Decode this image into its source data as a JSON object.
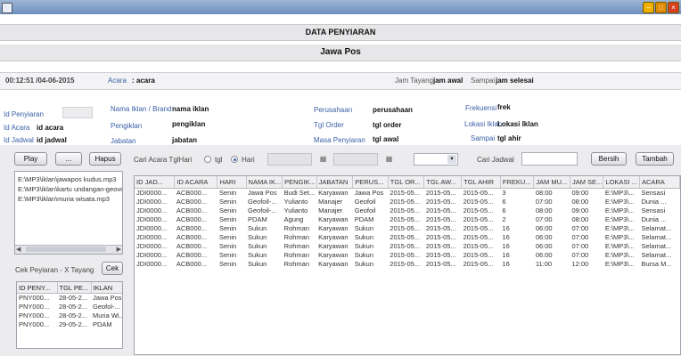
{
  "window": {
    "title": ""
  },
  "header": {
    "title": "DATA PENYIARAN",
    "subtitle": "Jawa Pos"
  },
  "infobar": {
    "clock": "00:12:51  /04-06-2015",
    "acara_label": "Acara",
    "acara_value": ": acara",
    "jam_tayang_label": "Jam Tayang",
    "jam_tayang_value": "jam awal",
    "sampai_label": "Sampai",
    "sampai_value": "jam selesai"
  },
  "form": {
    "id_penyiaran_label": "Id Penyiaran",
    "id_acara_label": "Id Acara",
    "id_acara_value": "id acara",
    "id_jadwal_label": "Id Jadwal",
    "id_jadwal_value": "id jadwal",
    "nama_iklan_label": "Nama Iklan / Brand",
    "nama_iklan_value": "nama iklan",
    "pengiklan_label": "Pengiklan",
    "pengiklan_value": "pengiklan",
    "jabatan_label": "Jabatan",
    "jabatan_value": "jabatan",
    "perusahaan_label": "Perusahaan",
    "perusahaan_value": "perusahaan",
    "tgl_order_label": "Tgl Order",
    "tgl_order_value": "tgl order",
    "masa_label": "Masa Penyiaran",
    "masa_value": "tgl awal",
    "frekuensi_label": "Frekuensi",
    "frekuensi_value": "frek",
    "lokasi_label": "Lokasi Iklan",
    "lokasi_value": "Lokasi Iklan",
    "sampai_label": "Sampai",
    "sampai_value": "tgl ahir"
  },
  "left": {
    "play_label": "Play",
    "browse_label": "...",
    "hapus_label": "Hapus",
    "files": [
      "E:\\MP3\\iklan\\jawapos ‌kudus.mp3",
      "E:\\MP3\\iklan\\kartu undangan-geovo",
      "E:\\MP3\\iklan\\muria wisata.mp3"
    ],
    "cek_label": "Cek Peyiaran  -  X Tayang",
    "cek_button": "Cek",
    "mini_headers": [
      "ID PENY...",
      "TGL PE...",
      "IKLAN"
    ],
    "mini_rows": [
      [
        "PNY000...",
        "28-05-2...",
        "Jawa Pos"
      ],
      [
        "PNY000...",
        "28-05-2...",
        "Geofol-..."
      ],
      [
        "PNY000...",
        "28-05-2...",
        "Muria Wi..."
      ],
      [
        "PNY000...",
        "29-05-2...",
        "PDAM"
      ]
    ]
  },
  "toolbar": {
    "cari_acara_label": "Cari Acara TglHari",
    "radio_tgl": "tgl",
    "radio_hari": "Hari",
    "cari_jadwal_label": "Cari Jadwal",
    "bersih_label": "Bersih",
    "tambah_label": "Tambah"
  },
  "table": {
    "headers": [
      "ID JAD...",
      "ID ACARA",
      "HARI",
      "NAMA IK...",
      "PENGIK...",
      "JABATAN",
      "PERUS...",
      "TGL OR...",
      "TGL AW...",
      "TGL AHIR",
      "FREKU...",
      "JAM MU...",
      "JAM SE...",
      "LOKASI ...",
      "ACARA"
    ],
    "rows": [
      [
        "JDI0000...",
        "ACB000...",
        "Senin",
        "Jawa Pos",
        "Budi Set...",
        "Karyawan",
        "Jawa Pos",
        "2015-05...",
        "2015-05...",
        "2015-05...",
        "3",
        "08:00",
        "09:00",
        "E:\\MP3\\...",
        "Sensasi"
      ],
      [
        "JDI0000...",
        "ACB000...",
        "Senin",
        "Geofoil-...",
        "Yulianto",
        "Manajer",
        "Geofoil",
        "2015-05...",
        "2015-05...",
        "2015-05...",
        "6",
        "07:00",
        "08:00",
        "E:\\MP3\\...",
        "Dunia ..."
      ],
      [
        "JDI0000...",
        "ACB000...",
        "Senin",
        "Geofoil-...",
        "Yulianto",
        "Manajer",
        "Geofoil",
        "2015-05...",
        "2015-05...",
        "2015-05...",
        "6",
        "08:00",
        "09:00",
        "E:\\MP3\\...",
        "Sensasi"
      ],
      [
        "JDI0000...",
        "ACB000...",
        "Senin",
        "PDAM",
        "Agung",
        "Karyawan",
        "PDAM",
        "2015-05...",
        "2015-05...",
        "2015-05...",
        "2",
        "07:00",
        "08:00",
        "E:\\MP3\\...",
        "Dunia ..."
      ],
      [
        "JDI0000...",
        "ACB000...",
        "Senin",
        "Sukun",
        "Rohman",
        "Karyawan",
        "Sukun",
        "2015-05...",
        "2015-05...",
        "2015-05...",
        "16",
        "06:00",
        "07:00",
        "E:\\MP3\\...",
        "Selamat..."
      ],
      [
        "JDI0000...",
        "ACB000...",
        "Senin",
        "Sukun",
        "Rohman",
        "Karyawan",
        "Sukun",
        "2015-05...",
        "2015-05...",
        "2015-05...",
        "16",
        "06:00",
        "07:00",
        "E:\\MP3\\...",
        "Selamat..."
      ],
      [
        "JDI0000...",
        "ACB000...",
        "Senin",
        "Sukun",
        "Rohman",
        "Karyawan",
        "Sukun",
        "2015-05...",
        "2015-05...",
        "2015-05...",
        "16",
        "06:00",
        "07:00",
        "E:\\MP3\\...",
        "Selamat..."
      ],
      [
        "JDI0000...",
        "ACB000...",
        "Senin",
        "Sukun",
        "Rohman",
        "Karyawan",
        "Sukun",
        "2015-05...",
        "2015-05...",
        "2015-05...",
        "16",
        "06:00",
        "07:00",
        "E:\\MP3\\...",
        "Selamat..."
      ],
      [
        "JDI0000...",
        "ACB000...",
        "Senin",
        "Sukun",
        "Rohman",
        "Karyawan",
        "Sukun",
        "2015-05...",
        "2015-05...",
        "2015-05...",
        "16",
        "11:00",
        "12:00",
        "E:\\MP3\\...",
        "Bursa M..."
      ]
    ]
  },
  "colors": {
    "title_bar": "#7f9dc7",
    "label_blue": "#3a5fa6",
    "panel_bg": "#ececee"
  },
  "icons": {
    "calendar": "calendar-icon",
    "dropdown": "chevron-down-icon"
  }
}
